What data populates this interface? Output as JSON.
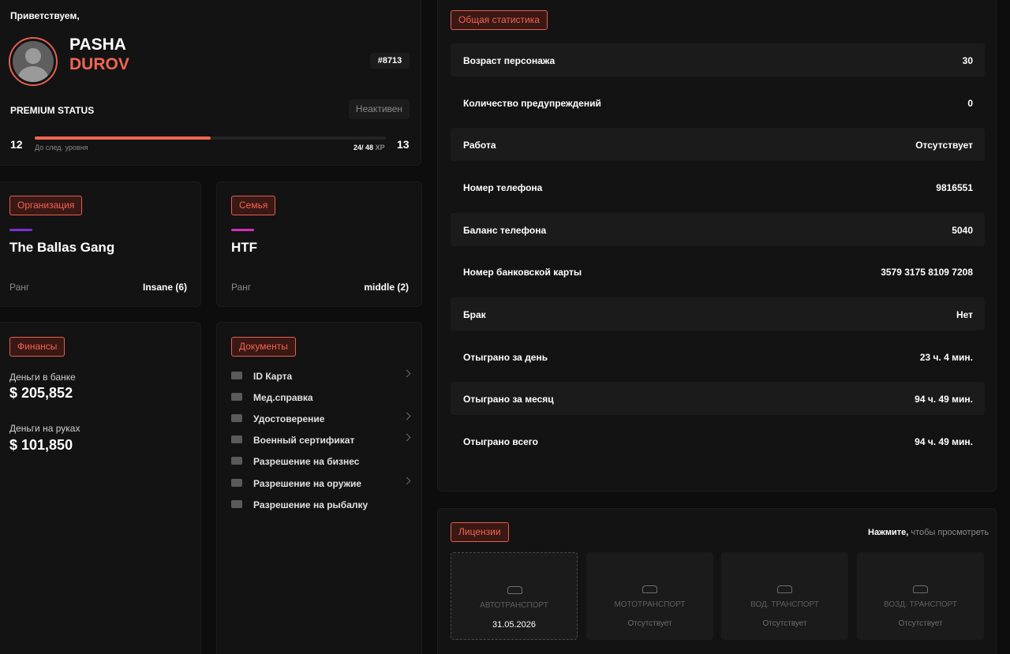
{
  "profile": {
    "greeting": "Приветствуем,",
    "first_name": "PASHA",
    "last_name": "DUROV",
    "id": "#8713",
    "premium_label": "PREMIUM STATUS",
    "premium_status": "Неактивен",
    "level_current": "12",
    "level_next": "13",
    "xp_caption": "До след. уровня",
    "xp_current": "24",
    "xp_total": "48",
    "xp_unit": "XP",
    "xp_fraction": 0.5
  },
  "organization": {
    "tag": "Организация",
    "name": "The Ballas Gang",
    "rank_label": "Ранг",
    "rank_value": "Insane (6)",
    "accent_color": "#7b2fd4"
  },
  "family": {
    "tag": "Семья",
    "name": "HTF",
    "rank_label": "Ранг",
    "rank_value": "middle (2)",
    "accent_color": "#d42fb8"
  },
  "finance": {
    "tag": "Финансы",
    "bank_label": "Деньги в банке",
    "bank_value": "$ 205,852",
    "cash_label": "Деньги на руках",
    "cash_value": "$ 101,850"
  },
  "documents": {
    "tag": "Документы",
    "items": [
      {
        "label": "ID Карта",
        "icon": "id-card-icon",
        "has_chevron": true
      },
      {
        "label": "Мед.справка",
        "icon": "medical-icon",
        "has_chevron": false
      },
      {
        "label": "Удостоверение",
        "icon": "badge-icon",
        "has_chevron": true
      },
      {
        "label": "Военный сертификат",
        "icon": "military-icon",
        "has_chevron": true
      },
      {
        "label": "Разрешение на бизнес",
        "icon": "briefcase-icon",
        "has_chevron": false
      },
      {
        "label": "Разрешение на оружие",
        "icon": "gun-icon",
        "has_chevron": true
      },
      {
        "label": "Разрешение на рыбалку",
        "icon": "fish-icon",
        "has_chevron": false
      }
    ]
  },
  "stats": {
    "tag": "Общая статистика",
    "rows": [
      {
        "key": "Возраст персонажа",
        "value": "30"
      },
      {
        "key": "Количество предупреждений",
        "value": "0"
      },
      {
        "key": "Работа",
        "value": "Отсутствует"
      },
      {
        "key": "Номер телефона",
        "value": "9816551"
      },
      {
        "key": "Баланс телефона",
        "value": "5040"
      },
      {
        "key": "Номер банковской карты",
        "value": "3579 3175 8109 7208"
      },
      {
        "key": "Брак",
        "value": "Нет"
      },
      {
        "key": "Отыграно за день",
        "value": "23 ч. 4 мин."
      },
      {
        "key": "Отыграно за месяц",
        "value": "94 ч. 49 мин."
      },
      {
        "key": "Отыграно всего",
        "value": "94 ч. 49 мин."
      }
    ]
  },
  "licenses": {
    "tag": "Лицензии",
    "hint_bold": "Нажмите,",
    "hint_rest": "чтобы просмотреть",
    "items": [
      {
        "title": "АВТОТРАНСПОРТ",
        "status": "31.05.2026",
        "icon": "car-icon",
        "active": true
      },
      {
        "title": "МОТОТРАНСПОРТ",
        "status": "Отсутствует",
        "icon": "motorcycle-icon",
        "active": false
      },
      {
        "title": "ВОД. ТРАНСПОРТ",
        "status": "Отсутствует",
        "icon": "boat-icon",
        "active": false
      },
      {
        "title": "ВОЗД. ТРАНСПОРТ",
        "status": "Отсутствует",
        "icon": "helicopter-icon",
        "active": false
      }
    ]
  },
  "colors": {
    "accent": "#f26552",
    "background": "#0d0d0d",
    "panel": "#131313",
    "row_alt": "#1b1b1b"
  }
}
